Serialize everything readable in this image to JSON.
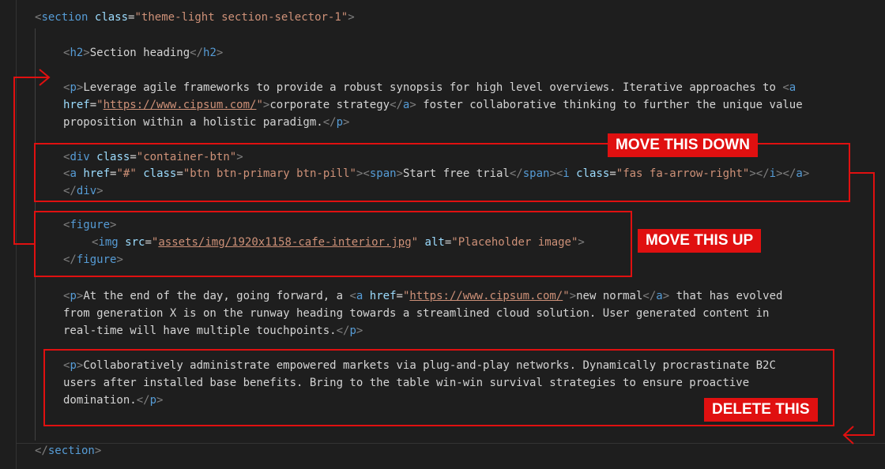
{
  "editor": {
    "section_open": {
      "tag": "section",
      "attr": "class",
      "value": "theme-light section-selector-1"
    },
    "h2": {
      "tag": "h2",
      "text": "Section heading"
    },
    "p1": {
      "tag": "p",
      "a_tag": "a",
      "text1": "Leverage agile frameworks to provide a robust synopsis for high level overviews. Iterative approaches to ",
      "href_attr": "href",
      "href_value": "https://www.cipsum.com/",
      "link_text": "corporate strategy",
      "text2": " foster collaborative thinking to further the unique value",
      "text3": "proposition within a holistic paradigm."
    },
    "btn_block": {
      "div_tag": "div",
      "div_attr": "class",
      "div_value": "container-btn",
      "a_tag": "a",
      "href_attr": "href",
      "href_value": "#",
      "class_attr": "class",
      "class_value": "btn btn-primary btn-pill",
      "span_tag": "span",
      "span_text": "Start free trial",
      "i_tag": "i",
      "i_class_value": "fas fa-arrow-right"
    },
    "figure": {
      "tag": "figure",
      "img_tag": "img",
      "src_attr": "src",
      "src_value": "assets/img/1920x1158-cafe-interior.jpg",
      "alt_attr": "alt",
      "alt_value": "Placeholder image"
    },
    "p2": {
      "tag": "p",
      "a_tag": "a",
      "text1": "At the end of the day, going forward, a ",
      "href_attr": "href",
      "href_value": "https://www.cipsum.com/",
      "link_text": "new normal",
      "text2": " that has evolved",
      "text3": "from generation X is on the runway heading towards a streamlined cloud solution. User generated content in",
      "text4": "real-time will have multiple touchpoints."
    },
    "p3": {
      "tag": "p",
      "text1": "Collaboratively administrate empowered markets via plug-and-play networks. Dynamically procrastinate B2C",
      "text2": "users after installed base benefits. Bring to the table win-win survival strategies to ensure proactive",
      "text3": "domination."
    },
    "section_close": {
      "tag": "section"
    }
  },
  "annotations": {
    "move_down": "MOVE THIS DOWN",
    "move_up": "MOVE THIS UP",
    "delete": "DELETE THIS",
    "color": "#e01010"
  },
  "colors": {
    "background": "#1e1e1e",
    "tag_bracket": "#808080",
    "tag_name": "#569cd6",
    "attr_name": "#9cdcfe",
    "attr_value": "#ce9178",
    "text": "#d4d4d4"
  }
}
